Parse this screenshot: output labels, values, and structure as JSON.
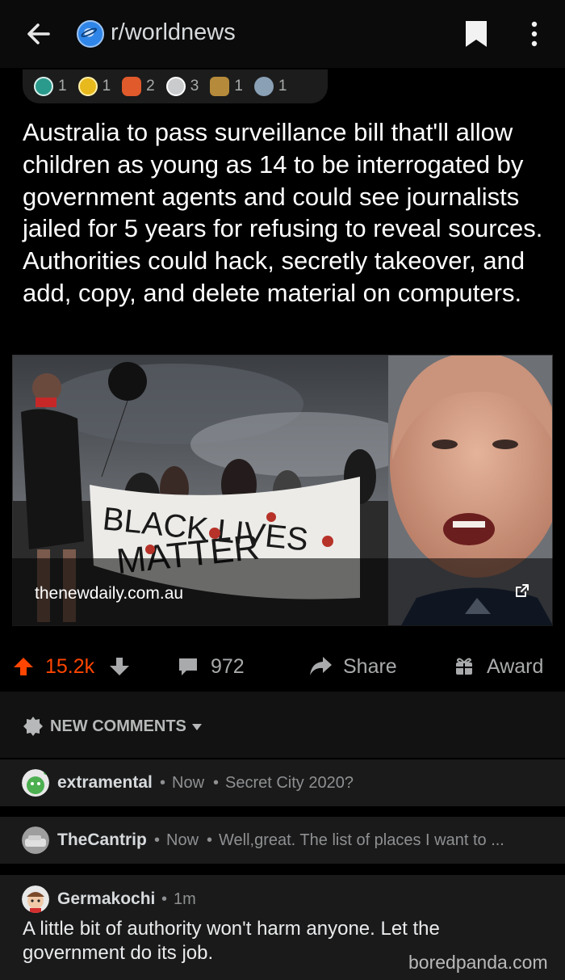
{
  "header": {
    "back_icon": "arrow-left-icon",
    "subreddit": "r/worldnews",
    "bookmark_icon": "bookmark-icon",
    "more_icon": "more-vertical-icon"
  },
  "awards": [
    {
      "icon": "helpful-award-icon",
      "count": "1",
      "color": "#2a9a8c"
    },
    {
      "icon": "gold-award-icon",
      "count": "1",
      "color": "#e8b91d"
    },
    {
      "icon": "wholesome-award-icon",
      "count": "2",
      "color": "#e05a2b"
    },
    {
      "icon": "silver-award-icon",
      "count": "3",
      "color": "#c9cbcc"
    },
    {
      "icon": "eagle-award-icon",
      "count": "1",
      "color": "#b58a3a"
    },
    {
      "icon": "facepalm-award-icon",
      "count": "1",
      "color": "#8aa0b5"
    }
  ],
  "post": {
    "title": "Australia to pass surveillance bill that'll allow children as young as 14 to be interrogated by government agents and could see journalists jailed for 5 years for refusing to reveal sources. Authorities could hack, secretly takeover, and add, copy, and delete material on computers.",
    "link_domain": "thenewdaily.com.au",
    "external_link_icon": "external-link-icon",
    "banner_text_line1": "BLACK LIVES",
    "banner_text_line2": "MATTER"
  },
  "actions": {
    "upvote_icon": "upvote-arrow-icon",
    "score": "15.2k",
    "downvote_icon": "downvote-arrow-icon",
    "comment_icon": "comment-bubble-icon",
    "comment_count": "972",
    "share_icon": "share-arrow-icon",
    "share_label": "Share",
    "award_icon": "gift-icon",
    "award_label": "Award",
    "accent": "#ff4500"
  },
  "sort": {
    "icon": "new-badge-icon",
    "label": "NEW COMMENTS",
    "caret_icon": "caret-down-icon"
  },
  "comments": [
    {
      "author": "extramental",
      "sep1": "•",
      "time": "Now",
      "sep2": "•",
      "preview": "Secret City 2020?"
    },
    {
      "author": "TheCantrip",
      "sep1": "•",
      "time": "Now",
      "sep2": "•",
      "preview": "Well,great. The list of places I want to ..."
    },
    {
      "author": "Germakochi",
      "sep1": "•",
      "time": "1m",
      "body": "A little bit of authority won't harm anyone. Let the government do its job."
    }
  ],
  "watermark": "boredpanda.com"
}
